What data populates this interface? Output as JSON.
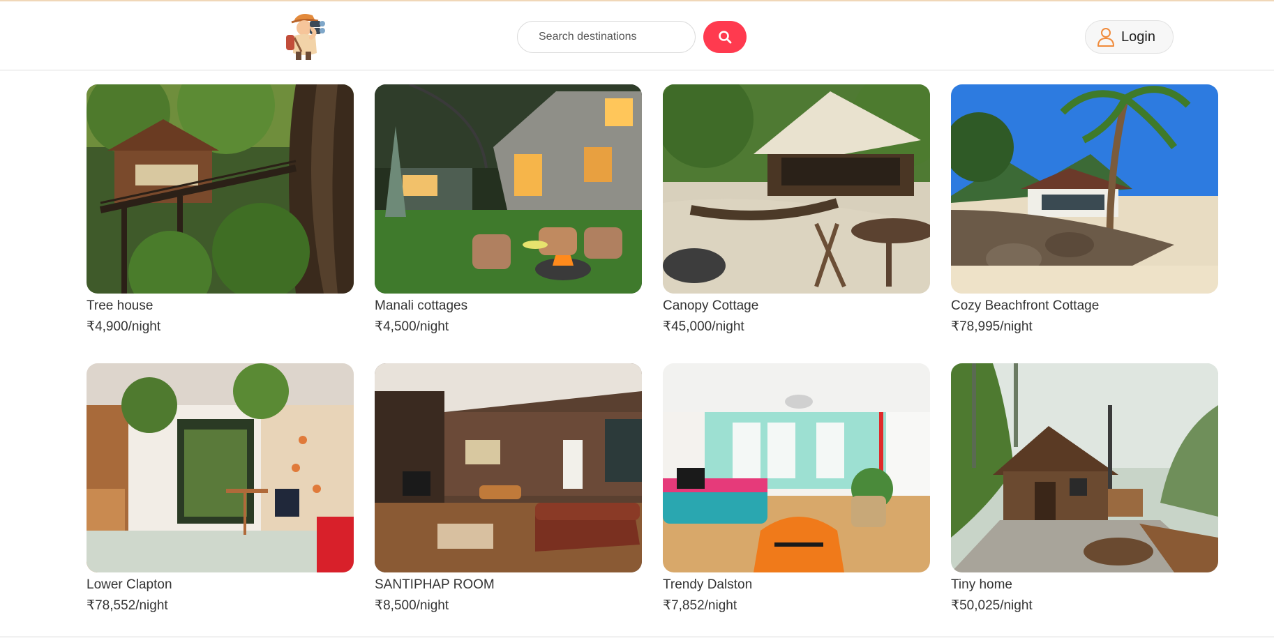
{
  "header": {
    "logo_icon": "explorer-binoculars-logo",
    "search": {
      "placeholder": "Search destinations",
      "value": ""
    },
    "search_button_icon": "search-icon",
    "login": {
      "label": "Login",
      "icon": "user-icon"
    }
  },
  "colors": {
    "accent": "#ff3a4f",
    "login_icon": "#f08a3a",
    "text": "#333333"
  },
  "listings": [
    {
      "title": "Tree house",
      "price": "₹4,900/night"
    },
    {
      "title": "Manali cottages",
      "price": "₹4,500/night"
    },
    {
      "title": "Canopy Cottage",
      "price": "₹45,000/night"
    },
    {
      "title": "Cozy Beachfront Cottage",
      "price": "₹78,995/night"
    },
    {
      "title": "Lower Clapton",
      "price": "₹78,552/night"
    },
    {
      "title": "SANTIPHAP ROOM",
      "price": "₹8,500/night"
    },
    {
      "title": "Trendy Dalston",
      "price": "₹7,852/night"
    },
    {
      "title": "Tiny home",
      "price": "₹50,025/night"
    }
  ]
}
